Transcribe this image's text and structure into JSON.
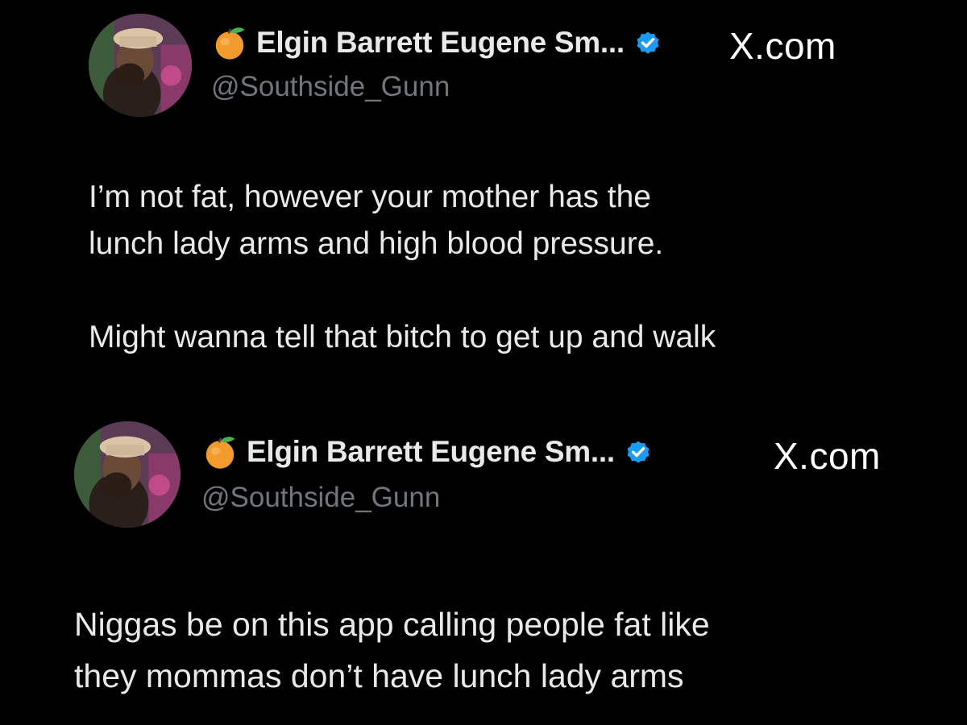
{
  "tweets": [
    {
      "display_name": "Elgin Barrett Eugene Sm...",
      "handle": "@Southside_Gunn",
      "site": "X.com",
      "paragraphs": [
        [
          "I’m not fat, however your mother has the",
          "lunch lady arms and high blood pressure."
        ],
        [
          "Might wanna tell that bitch to get up and walk"
        ]
      ]
    },
    {
      "display_name": "Elgin Barrett Eugene Sm...",
      "handle": "@Southside_Gunn",
      "site": "X.com",
      "paragraphs": [
        [
          "Niggas be on this app calling people fat like",
          "they mommas don’t have lunch lady arms"
        ]
      ]
    }
  ],
  "icons": {
    "name_emoji": "peach-icon",
    "verified": "verified-badge-icon",
    "avatar": "avatar-photo"
  },
  "colors": {
    "background": "#000000",
    "primary_text": "#e7e9ea",
    "secondary_text": "#71767b",
    "verified_blue": "#1d9bf0",
    "peach_orange": "#f5a23a"
  }
}
